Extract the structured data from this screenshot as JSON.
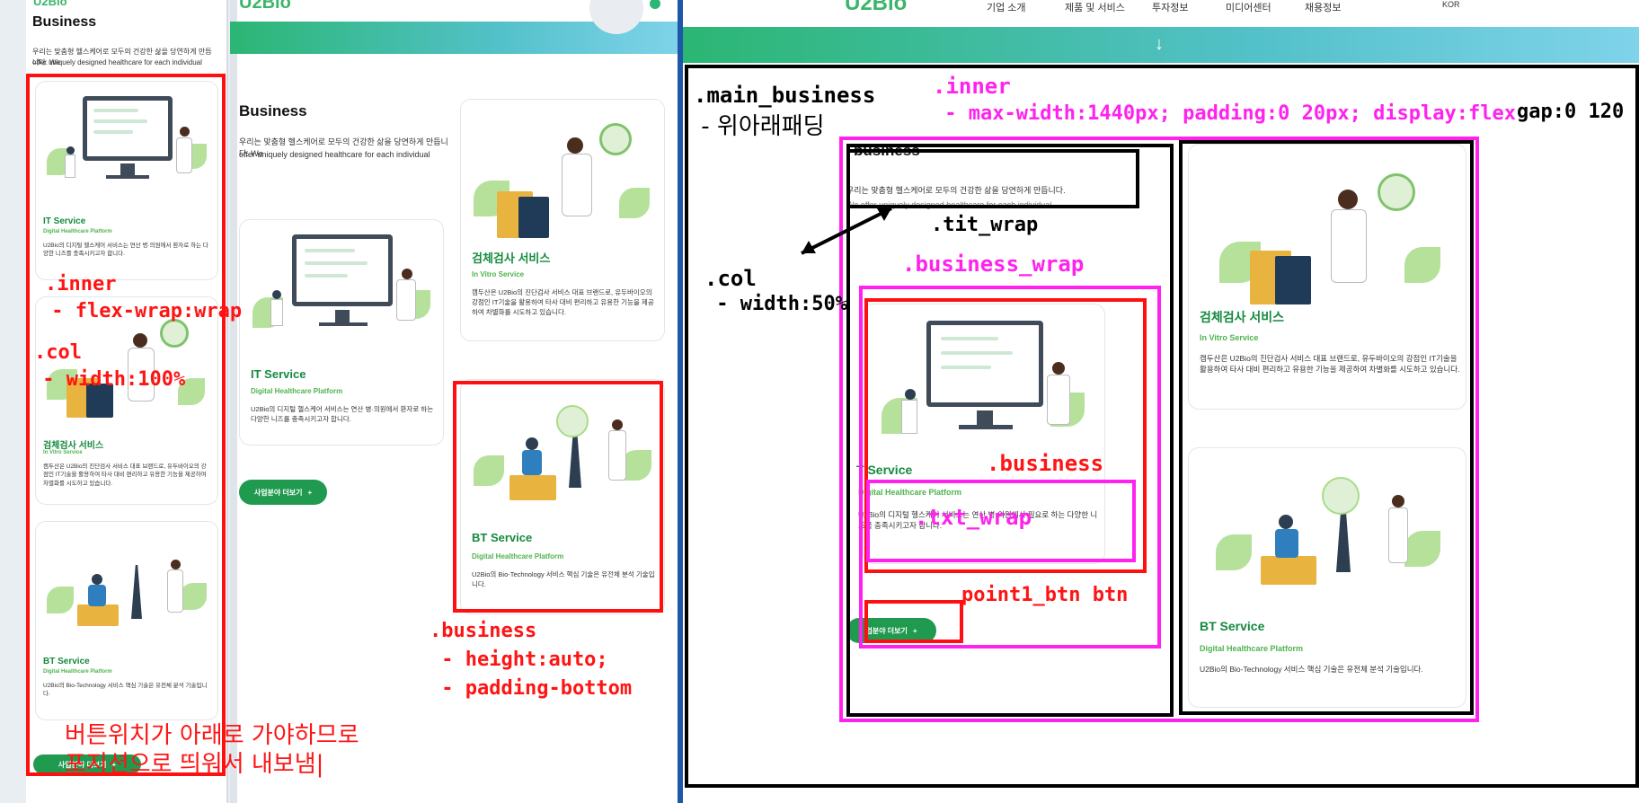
{
  "brand": {
    "logo": "U2Bio"
  },
  "nav": {
    "items": [
      "기업 소개",
      "제품 및 서비스",
      "투자정보",
      "미디어센터",
      "채용정보"
    ],
    "lang": "KOR"
  },
  "section": {
    "title": "Business",
    "desc_ko": "우리는 맞춤형 헬스케어로 모두의 건강한 삶을 당연하게 만듭니다. We",
    "desc_en": "offer uniquely designed healthcare for each individual",
    "desc_ko_right": "우리는 맞춤형 헬스케어로 모두의 건강한 삶을 당연하게 만듭니다.",
    "desc_en_right": "We offer uniquely designed healthcare for each individual"
  },
  "cards": {
    "it": {
      "title": "IT Service",
      "title_cut": "T Service",
      "sub": "Digital Healthcare Platform",
      "body": "U2Bio의 디지털 헬스케어 서비스는 연산 병·의원에서 환자로 하는 다양한 니즈를 충족시키고자 합니다.",
      "body_right": "U2Bio의 디지털 헬스케어 서비스는 연산 병·의원에서 필요로 하는 다양한 니즈를 충족시키고자 합니다."
    },
    "ivd": {
      "title": "검체검사 서비스",
      "sub": "In Vitro Service",
      "body": "캠두산은 U2Bio의 진단검사 서비스 대표 브랜드로, 유두바이오의 강점인 IT기술을 활용하여 타사 대비 편리하고 유용한 기능을 제공하여 차별화를 시도하고 있습니다."
    },
    "bt": {
      "title": "BT Service",
      "sub": "Digital Healthcare Platform",
      "body": "U2Bio의 Bio-Technology 서비스 핵심 기술은 유전체 분석 기술입니다."
    }
  },
  "more_button": {
    "label": "사업분야 더보기",
    "icon": "plus-icon",
    "label_cut": "업분야 더보기"
  },
  "down_arrow": "↓",
  "annotations": {
    "left": {
      "inner": ".inner",
      "inner_prop": " - flex-wrap:wrap",
      "col": ".col",
      "col_prop": " - width:100%",
      "note_line1": "버튼위치가 아래로 가야하므로",
      "note_line2": "포지션으로 띄워서 내보냄|"
    },
    "middle": {
      "business": ".business",
      "height": " - height:auto;",
      "padding": " - padding-bottom"
    },
    "right": {
      "main_business": ".main_business",
      "main_business_sub": " - 위아래패딩",
      "inner": ".inner",
      "inner_prop": " - max-width:1440px; padding:0 20px; display:flex",
      "gap": "gap:0 120",
      "tit_wrap": ".tit_wrap",
      "col": ".col",
      "col_prop": " - width:50%",
      "business_wrap": ".business_wrap",
      "business": ".business",
      "txt_wrap": ".txt_wrap",
      "point_btn": "point1_btn btn",
      "overlap_title": "business"
    }
  },
  "colors": {
    "green": "#158a3f",
    "light_green": "#4fb34f",
    "button_green": "#1f9a4f",
    "annotation_red": "#ff1010",
    "annotation_magenta": "#ff22ee"
  }
}
